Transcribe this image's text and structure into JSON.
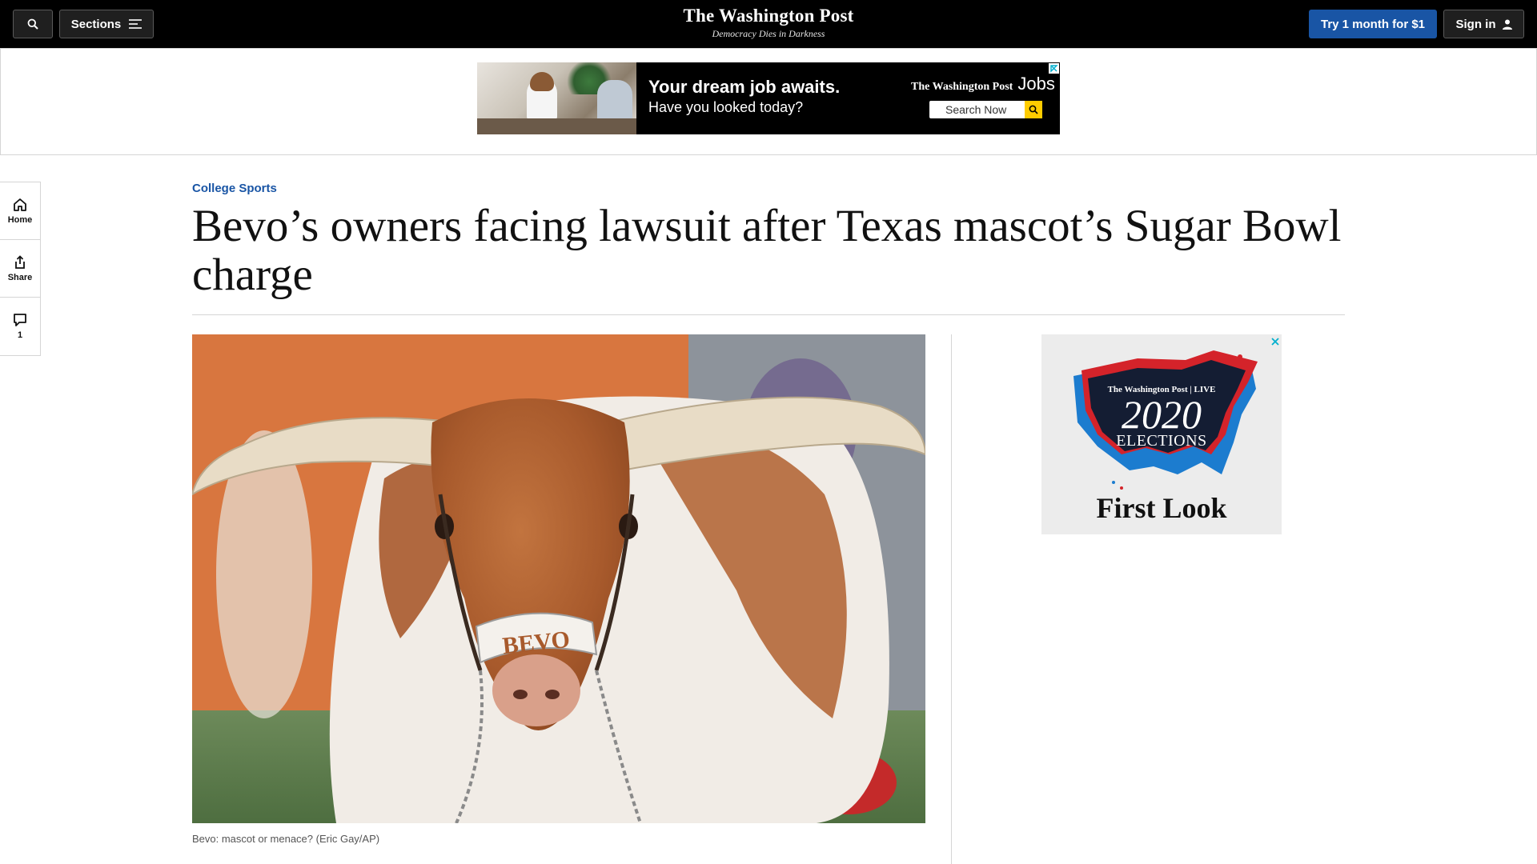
{
  "topbar": {
    "sections_label": "Sections",
    "masthead": "The Washington Post",
    "tagline": "Democracy Dies in Darkness",
    "subscribe_label": "Try 1 month for $1",
    "signin_label": "Sign in"
  },
  "top_ad": {
    "headline": "Your dream job awaits.",
    "subhead": "Have you looked today?",
    "brand": "The Washington Post",
    "brand_suffix": "Jobs",
    "search_button": "Search Now"
  },
  "rail": {
    "home_label": "Home",
    "share_label": "Share",
    "comments_count": "1"
  },
  "article": {
    "kicker": "College Sports",
    "headline": "Bevo’s owners facing lawsuit after Texas mascot’s Sugar Bowl charge",
    "caption": "Bevo: mascot or menace? (Eric Gay/AP)"
  },
  "hero_image": {
    "nose_band_text": "BEVO"
  },
  "side_ad": {
    "brand_line": "The Washington Post | LIVE",
    "year": "2020",
    "elections": "ELECTIONS",
    "first_look": "First Look"
  },
  "colors": {
    "topbar_bg": "#000000",
    "accent_blue": "#1955a5",
    "ad_yellow": "#ffcc00",
    "rule_gray": "#d5d5d5"
  },
  "icons": {
    "search": "search-icon",
    "sections": "hamburger-icon",
    "signin": "person-icon",
    "home": "home-icon",
    "share": "share-icon",
    "comments": "comment-icon",
    "ad_info": "ad-choices-icon",
    "ad_close": "close-icon"
  }
}
